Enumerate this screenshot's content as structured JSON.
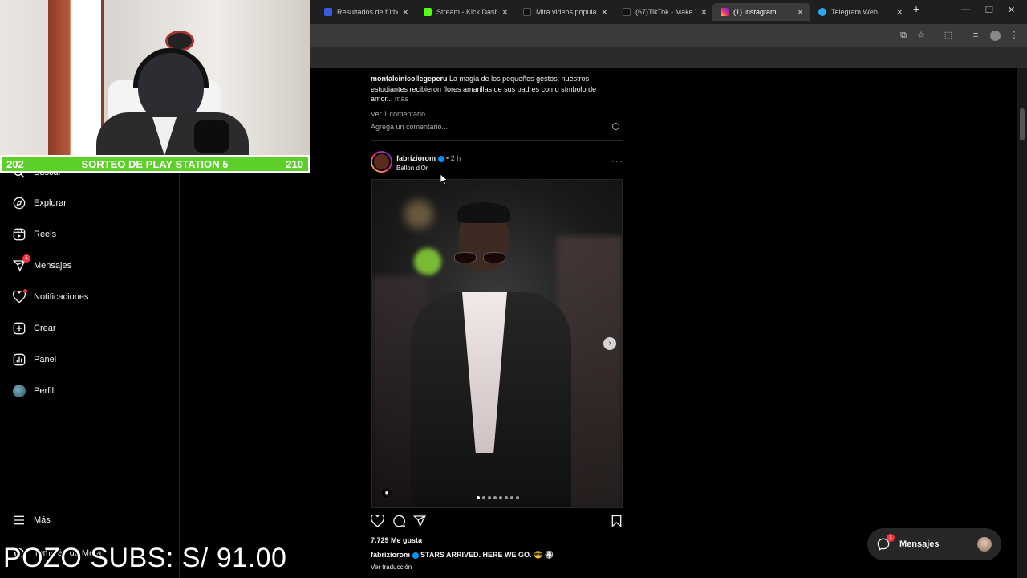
{
  "browser": {
    "tabs": [
      {
        "label": "Resultados de fútbol",
        "color": "#3b5bdb",
        "active": false
      },
      {
        "label": "Stream - Kick Dashbo",
        "color": "#53fc18",
        "active": false
      },
      {
        "label": "Mira videos popular",
        "color": "#111111",
        "active": false
      },
      {
        "label": "(67)TikTok - Make Yo",
        "color": "#111111",
        "active": false
      },
      {
        "label": "(1) Instagram",
        "color": "#e1306c",
        "active": true
      },
      {
        "label": "Telegram Web",
        "color": "#2aabee",
        "active": false
      }
    ],
    "new_tab": "+",
    "window_controls": {
      "minimize": "—",
      "restore": "❐",
      "close": "✕"
    }
  },
  "stream": {
    "score_left": "202",
    "title": "SORTEO DE PLAY STATION 5",
    "score_right": "210",
    "pozo": "POZO SUBS: S/ 91.00"
  },
  "sidebar": {
    "items": [
      {
        "label": "Buscar",
        "icon": "search-icon"
      },
      {
        "label": "Explorar",
        "icon": "compass-icon"
      },
      {
        "label": "Reels",
        "icon": "reels-icon"
      },
      {
        "label": "Mensajes",
        "icon": "messenger-icon",
        "badge": "1"
      },
      {
        "label": "Notificaciones",
        "icon": "heart-icon"
      },
      {
        "label": "Crear",
        "icon": "plus-square-icon"
      },
      {
        "label": "Panel",
        "icon": "chart-icon"
      },
      {
        "label": "Perfil",
        "icon": "avatar"
      }
    ],
    "more": "Más",
    "threads": "También de Meta"
  },
  "feed": {
    "prev_post": {
      "username": "montalcinicollegeperu",
      "caption": "La magia de los pequeños gestos: nuestros estudiantes recibieron flores amarillas de sus padres como símbolo de amor...",
      "more": "más",
      "view_comments": "Ver 1 comentario",
      "add_comment": "Agrega un comentario..."
    },
    "post": {
      "username": "fabriziorom",
      "time": "• 2 h",
      "location": "Ballon d'Or",
      "likes": "7.729 Me gusta",
      "caption": "STARS ARRIVED. HERE WE GO. 😎 🏵",
      "translate": "Ver traducción",
      "carousel_count": 8
    }
  },
  "messages_pill": {
    "label": "Mensajes",
    "badge": "1"
  },
  "colors": {
    "accent_red": "#ff3040",
    "verified_blue": "#0095f6",
    "stream_green": "#5ccf2b"
  }
}
